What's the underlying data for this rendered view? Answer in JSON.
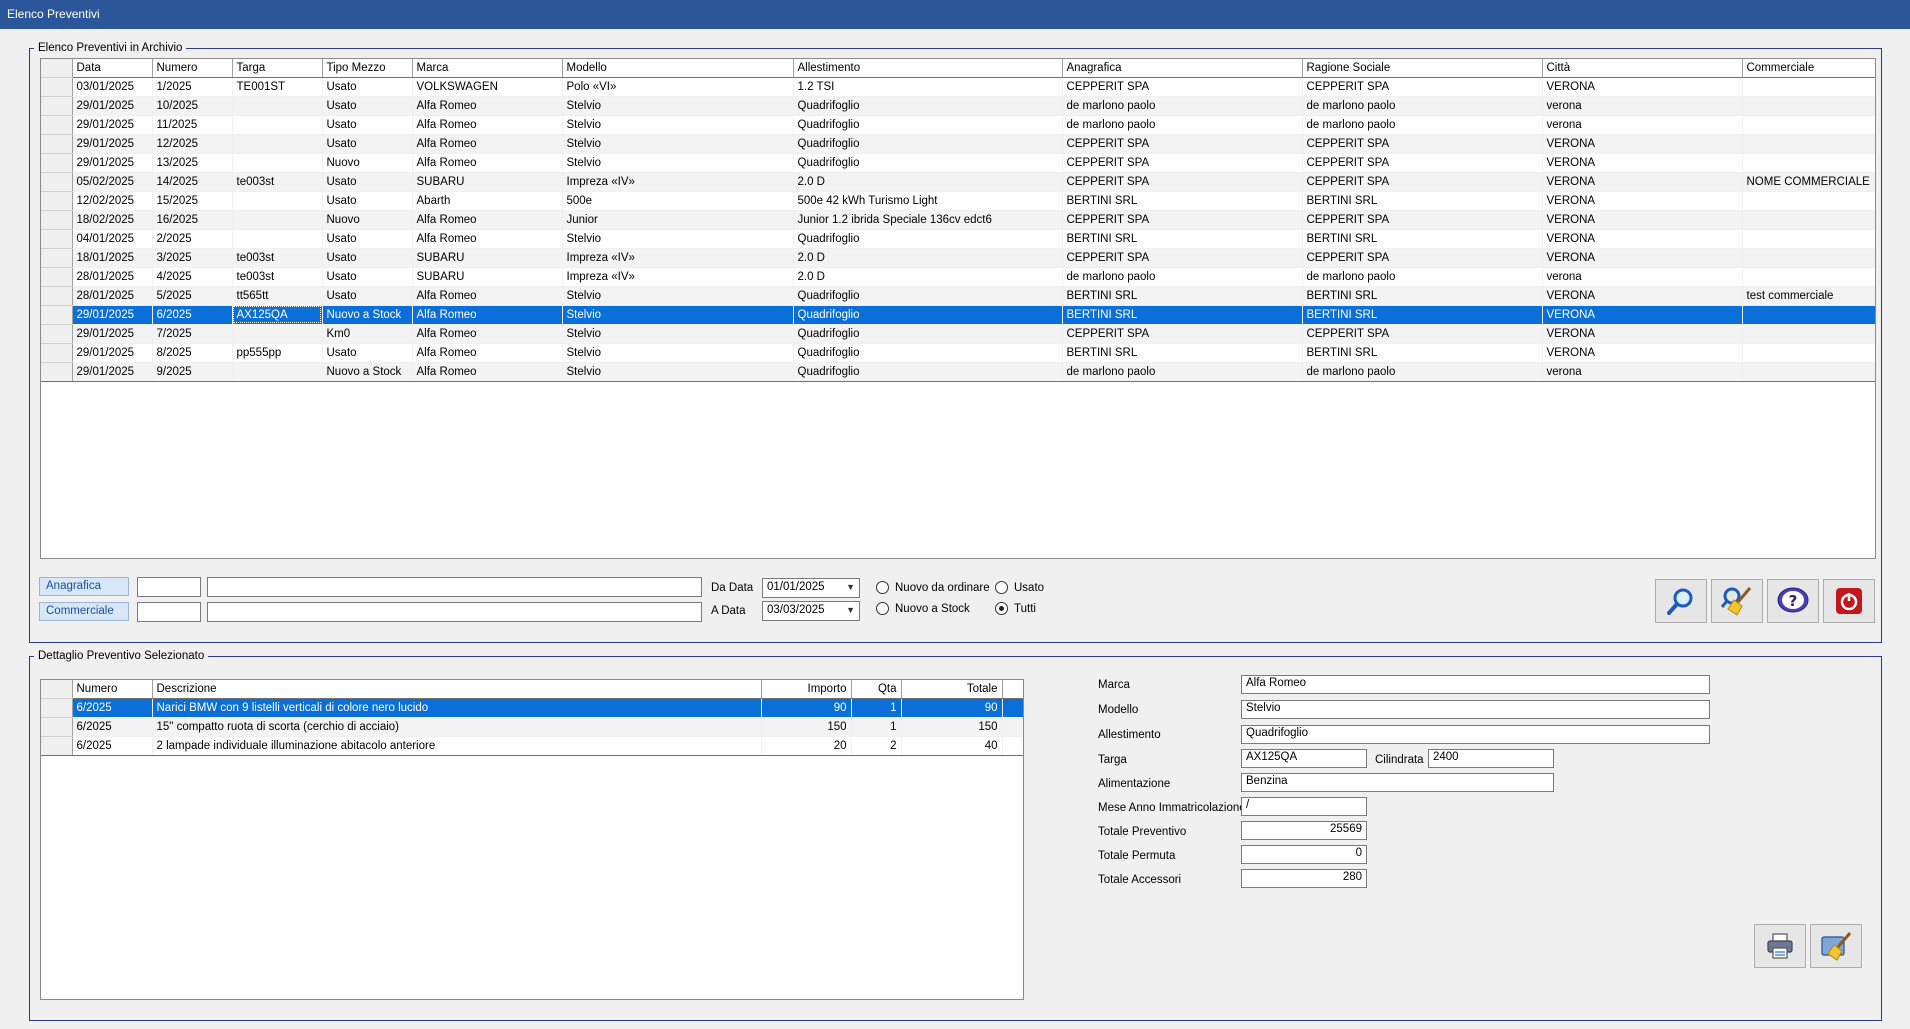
{
  "window": {
    "title": "Elenco Preventivi"
  },
  "archive": {
    "legend": "Elenco Preventivi in Archivio",
    "columns": [
      "Data",
      "Numero",
      "Targa",
      "Tipo Mezzo",
      "Marca",
      "Modello",
      "Allestimento",
      "Anagrafica",
      "Ragione Sociale",
      "Città",
      "Commerciale"
    ],
    "rows": [
      [
        "03/01/2025",
        "1/2025",
        "TE001ST",
        "Usato",
        "VOLKSWAGEN",
        "Polo «VI»",
        "1.2 TSI",
        "CEPPERIT SPA",
        "CEPPERIT SPA",
        "VERONA",
        ""
      ],
      [
        "29/01/2025",
        "10/2025",
        "",
        "Usato",
        "Alfa Romeo",
        "Stelvio",
        "Quadrifoglio",
        "de marlono paolo",
        "de marlono paolo",
        "verona",
        ""
      ],
      [
        "29/01/2025",
        "11/2025",
        "",
        "Usato",
        "Alfa Romeo",
        "Stelvio",
        "Quadrifoglio",
        "de marlono paolo",
        "de marlono paolo",
        "verona",
        ""
      ],
      [
        "29/01/2025",
        "12/2025",
        "",
        "Usato",
        "Alfa Romeo",
        "Stelvio",
        "Quadrifoglio",
        "CEPPERIT SPA",
        "CEPPERIT SPA",
        "VERONA",
        ""
      ],
      [
        "29/01/2025",
        "13/2025",
        "",
        "Nuovo",
        "Alfa Romeo",
        "Stelvio",
        "Quadrifoglio",
        "CEPPERIT SPA",
        "CEPPERIT SPA",
        "VERONA",
        ""
      ],
      [
        "05/02/2025",
        "14/2025",
        "te003st",
        "Usato",
        "SUBARU",
        "Impreza «IV»",
        "2.0 D",
        "CEPPERIT SPA",
        "CEPPERIT SPA",
        "VERONA",
        "NOME COMMERCIALE"
      ],
      [
        "12/02/2025",
        "15/2025",
        "",
        "Usato",
        "Abarth",
        "500e",
        "500e 42 kWh Turismo Light",
        "BERTINI SRL",
        "BERTINI SRL",
        "VERONA",
        ""
      ],
      [
        "18/02/2025",
        "16/2025",
        "",
        "Nuovo",
        "Alfa Romeo",
        "Junior",
        "Junior 1.2 ibrida Speciale 136cv edct6",
        "CEPPERIT SPA",
        "CEPPERIT SPA",
        "VERONA",
        ""
      ],
      [
        "04/01/2025",
        "2/2025",
        "",
        "Usato",
        "Alfa Romeo",
        "Stelvio",
        "Quadrifoglio",
        "BERTINI SRL",
        "BERTINI SRL",
        "VERONA",
        ""
      ],
      [
        "18/01/2025",
        "3/2025",
        "te003st",
        "Usato",
        "SUBARU",
        "Impreza «IV»",
        "2.0 D",
        "CEPPERIT SPA",
        "CEPPERIT SPA",
        "VERONA",
        ""
      ],
      [
        "28/01/2025",
        "4/2025",
        "te003st",
        "Usato",
        "SUBARU",
        "Impreza «IV»",
        "2.0 D",
        "de marlono paolo",
        "de marlono paolo",
        "verona",
        ""
      ],
      [
        "28/01/2025",
        "5/2025",
        "tt565tt",
        "Usato",
        "Alfa Romeo",
        "Stelvio",
        "Quadrifoglio",
        "BERTINI SRL",
        "BERTINI SRL",
        "VERONA",
        "test commerciale"
      ],
      [
        "29/01/2025",
        "6/2025",
        "AX125QA",
        "Nuovo a Stock",
        "Alfa Romeo",
        "Stelvio",
        "Quadrifoglio",
        "BERTINI SRL",
        "BERTINI SRL",
        "VERONA",
        ""
      ],
      [
        "29/01/2025",
        "7/2025",
        "",
        "Km0",
        "Alfa Romeo",
        "Stelvio",
        "Quadrifoglio",
        "CEPPERIT SPA",
        "CEPPERIT SPA",
        "VERONA",
        ""
      ],
      [
        "29/01/2025",
        "8/2025",
        "pp555pp",
        "Usato",
        "Alfa Romeo",
        "Stelvio",
        "Quadrifoglio",
        "BERTINI SRL",
        "BERTINI SRL",
        "VERONA",
        ""
      ],
      [
        "29/01/2025",
        "9/2025",
        "",
        "Nuovo a Stock",
        "Alfa Romeo",
        "Stelvio",
        "Quadrifoglio",
        "de marlono paolo",
        "de marlono paolo",
        "verona",
        ""
      ]
    ],
    "selected_row": 12
  },
  "filters": {
    "anagrafica_label": "Anagrafica",
    "anagrafica_code": "",
    "anagrafica_name": "",
    "commerciale_label": "Commerciale",
    "commerciale_code": "",
    "commerciale_name": "",
    "da_data_label": "Da Data",
    "da_data_value": "01/01/2025",
    "a_data_label": "A Data",
    "a_data_value": "03/03/2025",
    "radio_nuovo_ordinare": "Nuovo da ordinare",
    "radio_nuovo_stock": "Nuovo a Stock",
    "radio_usato": "Usato",
    "radio_tutti": "Tutti",
    "radio_selected": "Tutti"
  },
  "detail": {
    "legend": "Dettaglio Preventivo Selezionato",
    "columns": [
      "Numero",
      "Descrizione",
      "Importo",
      "Qta",
      "Totale"
    ],
    "rows": [
      [
        "6/2025",
        "Narici BMW con 9 listelli verticali di colore nero lucido",
        "90",
        "1",
        "90"
      ],
      [
        "6/2025",
        "15\" compatto ruota di scorta (cerchio di acciaio)",
        "150",
        "1",
        "150"
      ],
      [
        "6/2025",
        "2 lampade individuale illuminazione abitacolo anteriore",
        "20",
        "2",
        "40"
      ]
    ],
    "selected_row": 0,
    "fields": {
      "marca_label": "Marca",
      "marca": "Alfa Romeo",
      "modello_label": "Modello",
      "modello": "Stelvio",
      "allestimento_label": "Allestimento",
      "allestimento": "Quadrifoglio",
      "targa_label": "Targa",
      "targa": "AX125QA",
      "cilindrata_label": "Cilindrata",
      "cilindrata": "2400",
      "alimentazione_label": "Alimentazione",
      "alimentazione": "Benzina",
      "immatricolazione_label": "Mese Anno Immatricolazione",
      "immatricolazione": "/",
      "totale_preventivo_label": "Totale Preventivo",
      "totale_preventivo": "25569",
      "totale_permuta_label": "Totale Permuta",
      "totale_permuta": "0",
      "totale_accessori_label": "Totale Accessori",
      "totale_accessori": "280"
    }
  },
  "icons": {
    "search": "magnifier-icon",
    "clear": "broom-icon",
    "help": "help-question-icon",
    "exit": "power-exit-icon",
    "print": "printer-icon",
    "clear_detail": "broom-icon"
  }
}
